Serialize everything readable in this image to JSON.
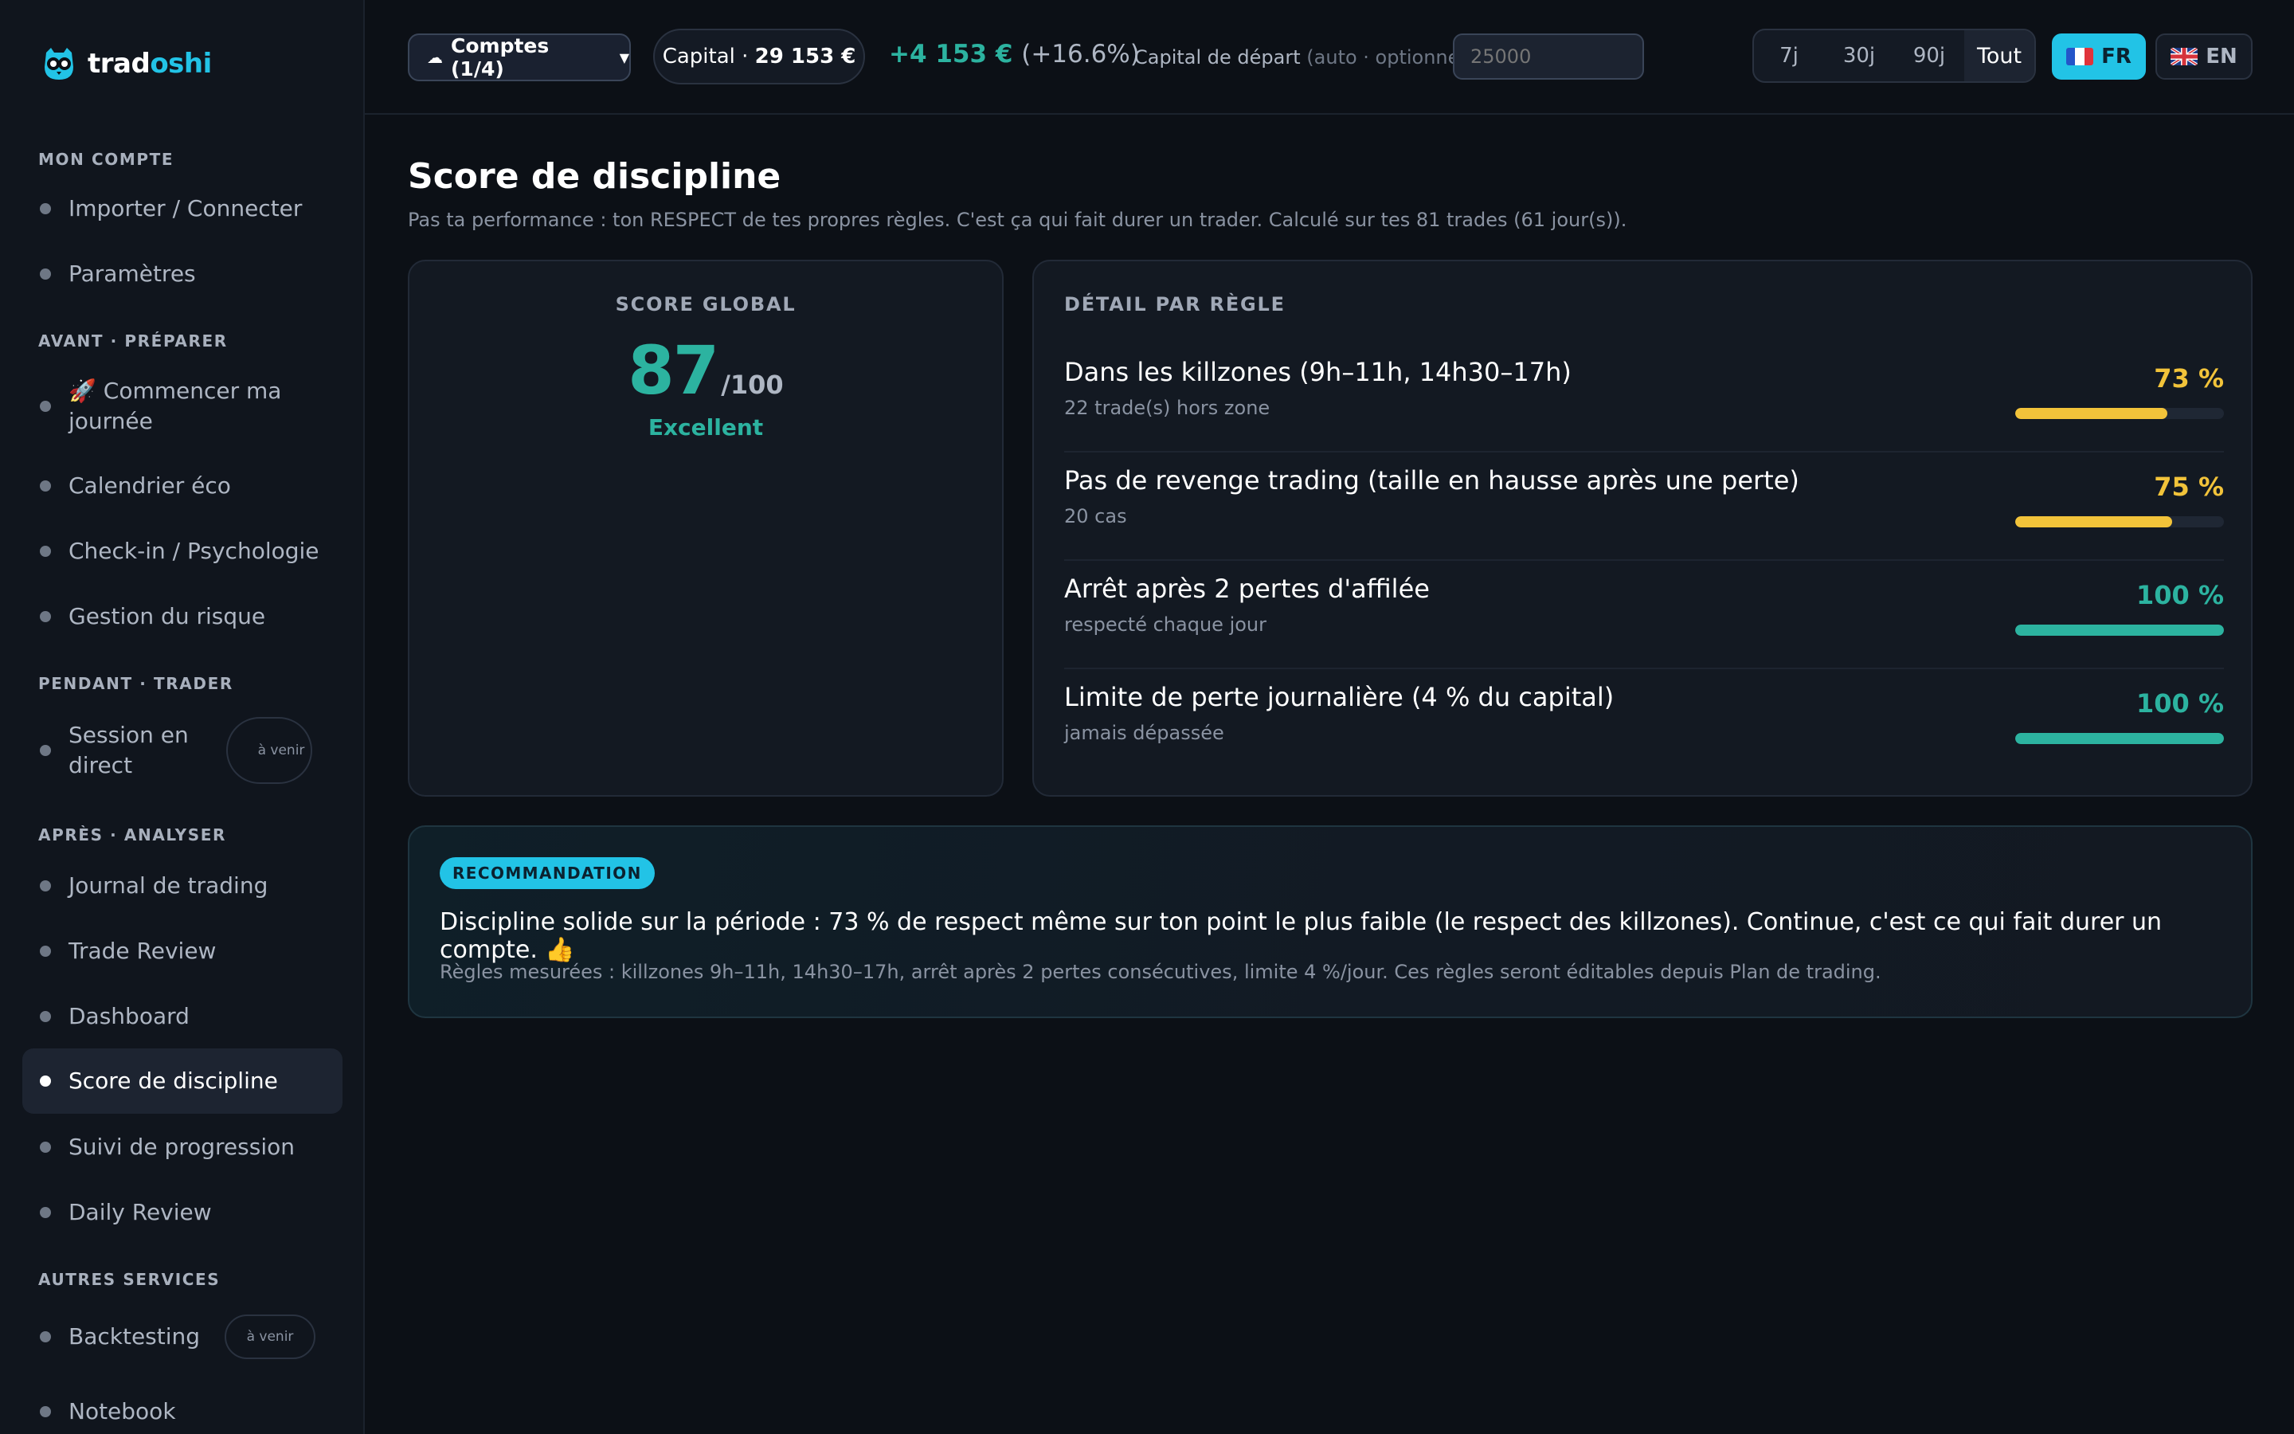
{
  "brand": {
    "name_part1": "trad",
    "name_part2": "oshi",
    "accent": "#22c3e6"
  },
  "sidebar": {
    "sections": [
      {
        "label": "MON COMPTE"
      },
      {
        "label": "AVANT · PRÉPARER"
      },
      {
        "label": "PENDANT · TRADER"
      },
      {
        "label": "APRÈS · ANALYSER"
      },
      {
        "label": "AUTRES SERVICES"
      }
    ],
    "items": [
      {
        "label": "Importer / Connecter"
      },
      {
        "label": "Paramètres"
      },
      {
        "label": "🚀 Commencer ma journée"
      },
      {
        "label": "Calendrier éco"
      },
      {
        "label": "Check-in / Psychologie"
      },
      {
        "label": "Gestion du risque"
      },
      {
        "label": "Session en direct",
        "badge": "à venir"
      },
      {
        "label": "Journal de trading"
      },
      {
        "label": "Trade Review"
      },
      {
        "label": "Dashboard"
      },
      {
        "label": "Score de discipline",
        "active": true
      },
      {
        "label": "Suivi de progression"
      },
      {
        "label": "Daily Review"
      },
      {
        "label": "Backtesting",
        "badge": "à venir"
      },
      {
        "label": "Notebook"
      }
    ]
  },
  "topbar": {
    "accounts_label": "Comptes (1/4)",
    "capital_prefix": "Capital ·",
    "capital_value": "29 153 €",
    "gain_value": "+4 153 €",
    "gain_pct": "(+16.6%)",
    "start_capital_label": "Capital de départ",
    "start_capital_hint": "(auto · optionnel)",
    "start_capital_placeholder": "25000",
    "ranges": [
      {
        "label": "7j"
      },
      {
        "label": "30j"
      },
      {
        "label": "90j"
      },
      {
        "label": "Tout",
        "active": true
      }
    ],
    "lang_fr": "FR",
    "lang_en": "EN"
  },
  "page": {
    "title": "Score de discipline",
    "subtitle": "Pas ta performance : ton RESPECT de tes propres règles. C'est ça qui fait durer un trader. Calculé sur tes 81 trades (61 jour(s))."
  },
  "score": {
    "title": "SCORE GLOBAL",
    "value": "87",
    "max": "/100",
    "grade": "Excellent",
    "color": "#2cb3a0"
  },
  "detail": {
    "title": "DÉTAIL PAR RÈGLE",
    "rules": [
      {
        "name": "Dans les killzones (9h–11h, 14h30–17h)",
        "sub": "22 trade(s) hors zone",
        "pct_label": "73 %",
        "pct": 73,
        "color": "#f2c33a"
      },
      {
        "name": "Pas de revenge trading (taille en hausse après une perte)",
        "sub": "20 cas",
        "pct_label": "75 %",
        "pct": 75,
        "color": "#f2c33a"
      },
      {
        "name": "Arrêt après 2 pertes d'affilée",
        "sub": "respecté chaque jour",
        "pct_label": "100 %",
        "pct": 100,
        "color": "#2cb3a0"
      },
      {
        "name": "Limite de perte journalière (4 % du capital)",
        "sub": "jamais dépassée",
        "pct_label": "100 %",
        "pct": 100,
        "color": "#2cb3a0"
      }
    ]
  },
  "recommendation": {
    "badge": "RECOMMANDATION",
    "text": "Discipline solide sur la période : 73 % de respect même sur ton point le plus faible (le respect des killzones). Continue, c'est ce qui fait durer un compte. 👍",
    "note": "Règles mesurées : killzones 9h–11h, 14h30–17h, arrêt après 2 pertes consécutives, limite 4 %/jour. Ces règles seront éditables depuis Plan de trading."
  }
}
